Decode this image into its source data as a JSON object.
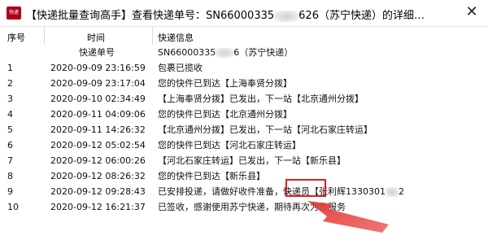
{
  "window": {
    "title_prefix": "【快递批量查询高手】查看快递单号：SN66000335",
    "title_suffix": "626（苏宁快递）的详细…",
    "app_icon_text": "快递",
    "close_symbol": "✕"
  },
  "table": {
    "headers": [
      "序号",
      "时间",
      "快递信息"
    ],
    "subheader": {
      "time": "快递单号",
      "info_prefix": "SN66000335",
      "info_suffix": "6（苏宁快递）"
    },
    "rows": [
      {
        "no": "1",
        "time": "2020-09-09 23:16:59",
        "info": "包裹已揽收"
      },
      {
        "no": "2",
        "time": "2020-09-09 23:17:04",
        "info": "您的快件已到达【上海奉贤分拨】"
      },
      {
        "no": "3",
        "time": "2020-09-10 02:34:49",
        "info": "【上海奉贤分拨】已发出，下一站【北京通州分拨】"
      },
      {
        "no": "4",
        "time": "2020-09-11 04:09:06",
        "info": "您的快件已到达【北京通州分拨】"
      },
      {
        "no": "5",
        "time": "2020-09-11 14:26:32",
        "info": "【北京通州分拨】已发出，下一站【河北石家庄转运】"
      },
      {
        "no": "6",
        "time": "2020-09-12 05:02:54",
        "info": "您的快件已到达【河北石家庄转运】"
      },
      {
        "no": "7",
        "time": "2020-09-12 06:00:26",
        "info": "【河北石家庄转运】已发出，下一站【新乐县】"
      },
      {
        "no": "8",
        "time": "2020-09-12 08:26:32",
        "info": "您的快件已到达【新乐县】"
      },
      {
        "no": "9",
        "time": "2020-09-12 09:28:43",
        "info": "已安排投递，请做好收件准备，快递员【张利辉1330301",
        "info_tail": "2"
      },
      {
        "no": "10",
        "time": "2020-09-12 16:21:37",
        "info": "已签收，感谢使用苏宁快递，期待再次为您服务"
      }
    ]
  },
  "colors": {
    "highlight": "#e02020"
  }
}
